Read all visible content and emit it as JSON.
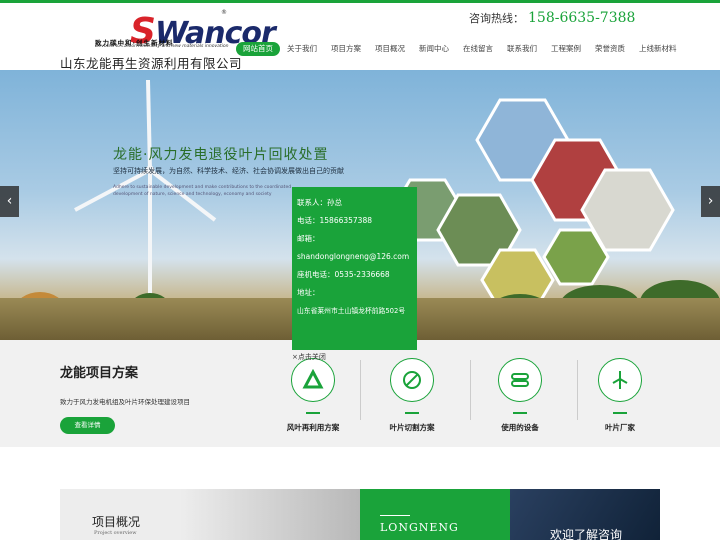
{
  "header": {
    "logo_text_s": "S",
    "logo_text_rest": "Wancor",
    "logo_reg": "®",
    "logo_slogan": "致力碳中和·创生新材料",
    "logo_en": "Devoted to carbon neutrality and new materials innovation",
    "company_name": "山东龙能再生资源利用有限公司",
    "hotline_label": "咨询热线：",
    "hotline_number": "158-6635-7388"
  },
  "nav": {
    "items": [
      {
        "label": "网站首页",
        "active": true
      },
      {
        "label": "关于我们"
      },
      {
        "label": "项目方案"
      },
      {
        "label": "项目概况"
      },
      {
        "label": "新闻中心"
      },
      {
        "label": "在线留言"
      },
      {
        "label": "联系我们"
      },
      {
        "label": "工程案例"
      },
      {
        "label": "荣誉资质"
      },
      {
        "label": "上线新材料"
      }
    ]
  },
  "banner": {
    "title": "龙能·风力发电退役叶片回收处置",
    "subtitle": "坚持可持续发展，为自然、科学技术、经济、社会协调发展做出自己的贡献",
    "en_text": "Adhere to sustainable development and make contributions to the coordinated development of nature, science and technology, economy and society",
    "prev_icon": "chevron-left-icon",
    "next_icon": "chevron-right-icon",
    "prev_glyph": "‹",
    "next_glyph": "›"
  },
  "contact_popup": {
    "contact_line": "联系人：孙总",
    "phone_line": "电话：15866357388",
    "email_label": "邮箱：",
    "email_value": "shandonglongneng@126.com",
    "landline_line": "座机电话：0535-2336668",
    "address_label": "地址：",
    "address_value": "山东省莱州市土山镇龙杯前路502号",
    "close_label": "×点击关闭"
  },
  "projects": {
    "title": "龙能项目方案",
    "description": "致力于风力发电机组及叶片环保处理建设项目",
    "button_label": "查看详情",
    "features": [
      {
        "label": "风叶再利用方案",
        "icon": "recycle-icon"
      },
      {
        "label": "叶片切割方案",
        "icon": "cutting-icon"
      },
      {
        "label": "使用的设备",
        "icon": "equipment-icon"
      },
      {
        "label": "叶片厂家",
        "icon": "wind-turbine-icon"
      }
    ]
  },
  "bottom": {
    "overview_title": "项目概况",
    "overview_sub": "Project overview",
    "brand_text": "LONGNENG",
    "consult_text": "欢迎了解咨询"
  },
  "colors": {
    "brand_green": "#1aa33a",
    "logo_red": "#d9232a",
    "logo_navy": "#1b2a6b"
  }
}
